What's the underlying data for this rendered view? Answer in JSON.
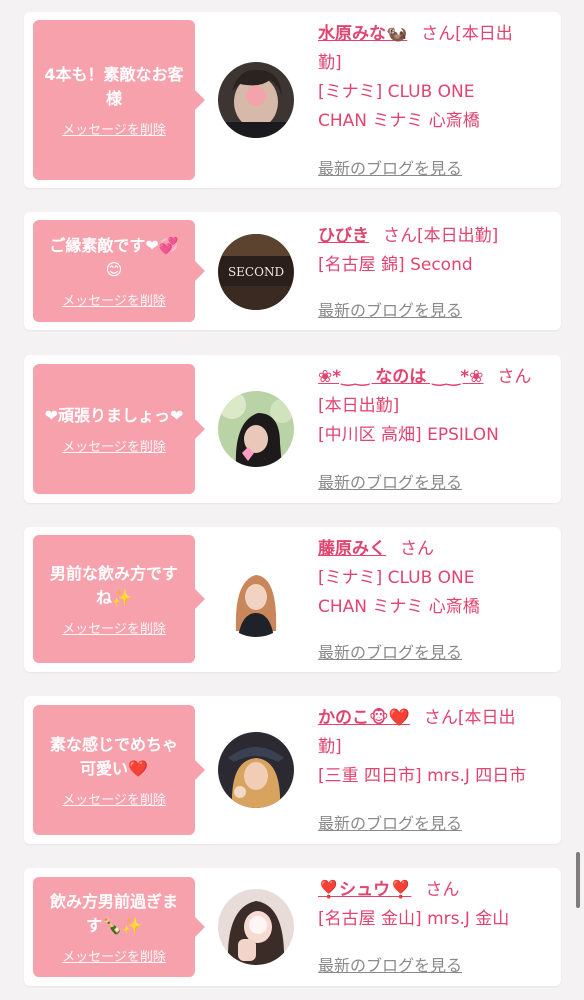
{
  "cards": [
    {
      "bubble_text": "4本も！素敵なお客様",
      "delete_label": "メッセージを削除",
      "name": "水原みな🦦",
      "suffix": "さん",
      "line1": "[本日出",
      "line2": "勤]",
      "line3": "[ミナミ] CLUB ONE",
      "line4": "CHAN ミナミ 心斎橋",
      "blog_label": "最新のブログを見る"
    },
    {
      "bubble_text": "ご縁素敵です❤💞😊",
      "delete_label": "メッセージを削除",
      "name": "ひびき",
      "suffix": "さん",
      "line1": "[本日出勤]",
      "line3": "[名古屋 錦] Second",
      "blog_label": "最新のブログを見る"
    },
    {
      "bubble_text": "❤頑張りましょっ❤",
      "delete_label": "メッセージを削除",
      "name": "❀*‿‿ なのは ‿‿*❀",
      "suffix": "さん",
      "line2": "[本日出勤]",
      "line3": "[中川区 高畑] EPSILON",
      "blog_label": "最新のブログを見る"
    },
    {
      "bubble_text": "男前な飲み方ですね✨",
      "delete_label": "メッセージを削除",
      "name": "藤原みく",
      "suffix": "さん",
      "line3": "[ミナミ] CLUB ONE",
      "line4": "CHAN ミナミ 心斎橋",
      "blog_label": "最新のブログを見る"
    },
    {
      "bubble_text": "素な感じでめちゃ可愛い❤️",
      "delete_label": "メッセージを削除",
      "name": "かのこ🐵❤️",
      "suffix": "さん",
      "line1": "[本日出",
      "line2": "勤]",
      "line3": "[三重 四日市] mrs.J 四日市",
      "blog_label": "最新のブログを見る"
    },
    {
      "bubble_text": "飲み方男前過ぎます🍾✨",
      "delete_label": "メッセージを削除",
      "name": "❣️シュウ❣️",
      "suffix": "さん",
      "line3": "[名古屋 金山] mrs.J 金山",
      "blog_label": "最新のブログを見る"
    }
  ],
  "avatar_labels": {
    "c2": "SECOND"
  },
  "colors": {
    "accent": "#e0446f",
    "bubble": "#f7a1ad",
    "link_gray": "#8a8a8a"
  }
}
